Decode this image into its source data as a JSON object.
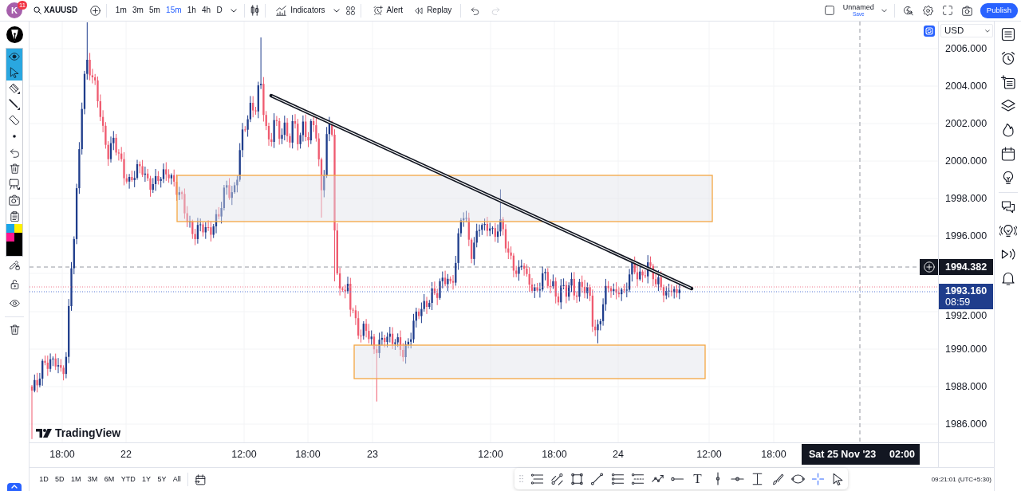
{
  "top_bar": {
    "avatar": {
      "initial": "K",
      "badge": "11"
    },
    "symbol": "XAUUSD",
    "intervals": [
      {
        "label": "1m",
        "selected": false
      },
      {
        "label": "3m",
        "selected": false
      },
      {
        "label": "5m",
        "selected": false
      },
      {
        "label": "15m",
        "selected": true
      },
      {
        "label": "1h",
        "selected": false
      },
      {
        "label": "4h",
        "selected": false
      },
      {
        "label": "D",
        "selected": false
      }
    ],
    "indicators": "Indicators",
    "alert": "Alert",
    "replay": "Replay",
    "history": [
      {
        "disabled": false
      },
      {
        "disabled": true
      }
    ],
    "layout": {
      "name": "Unnamed",
      "status": "Save"
    },
    "publish": "Publish"
  },
  "left_toolbar": {
    "panel_tools": [
      {
        "selected": true
      },
      {
        "selected": true
      },
      {
        "selected": false
      },
      {
        "selected": false
      },
      {
        "selected": false
      },
      {
        "selected": false
      },
      {
        "selected": false
      },
      {
        "selected": false
      },
      {
        "selected": false
      },
      {
        "selected": false
      },
      {
        "selected": false
      }
    ],
    "swatches": [
      {
        "color": "#1aa5e8"
      },
      {
        "color": "#fff100"
      },
      {
        "color": "#ff168c"
      },
      {
        "color": "#000000"
      },
      {
        "color": "#000000"
      },
      {
        "color": "#000000"
      }
    ]
  },
  "chart": {
    "currency": "USD",
    "price_labels": [
      "2006.000",
      "2004.000",
      "2002.000",
      "2000.000",
      "1998.000",
      "1996.000",
      "1992.000",
      "1990.000",
      "1988.000",
      "1986.000"
    ],
    "crosshair_price": "1994.382",
    "last_price": {
      "price": "1993.160",
      "countdown": "08:59"
    },
    "time_labels": [
      "18:00",
      "22",
      "12:00",
      "18:00",
      "23",
      "12:00",
      "18:00",
      "24",
      "12:00",
      "18:00"
    ],
    "crosshair_time": {
      "date": "Sat 25 Nov '23",
      "time": "02:00"
    },
    "logo": "TradingView"
  },
  "bottom_bar": {
    "ranges": [
      "1D",
      "5D",
      "1M",
      "3M",
      "6M",
      "YTD",
      "1Y",
      "5Y",
      "All"
    ],
    "clock": "09:21:01 (UTC+5:30)"
  },
  "drawing_toolbar": {
    "tools": [
      {
        "selected": false
      },
      {
        "selected": false
      },
      {
        "selected": false
      },
      {
        "selected": false
      },
      {
        "selected": false
      },
      {
        "selected": false
      },
      {
        "selected": false
      },
      {
        "selected": false
      },
      {
        "glyph": "T",
        "selected": false
      },
      {
        "selected": false
      },
      {
        "selected": false
      },
      {
        "selected": false
      },
      {
        "selected": false
      },
      {
        "selected": false
      },
      {
        "selected": true
      },
      {
        "selected": false
      }
    ]
  }
}
